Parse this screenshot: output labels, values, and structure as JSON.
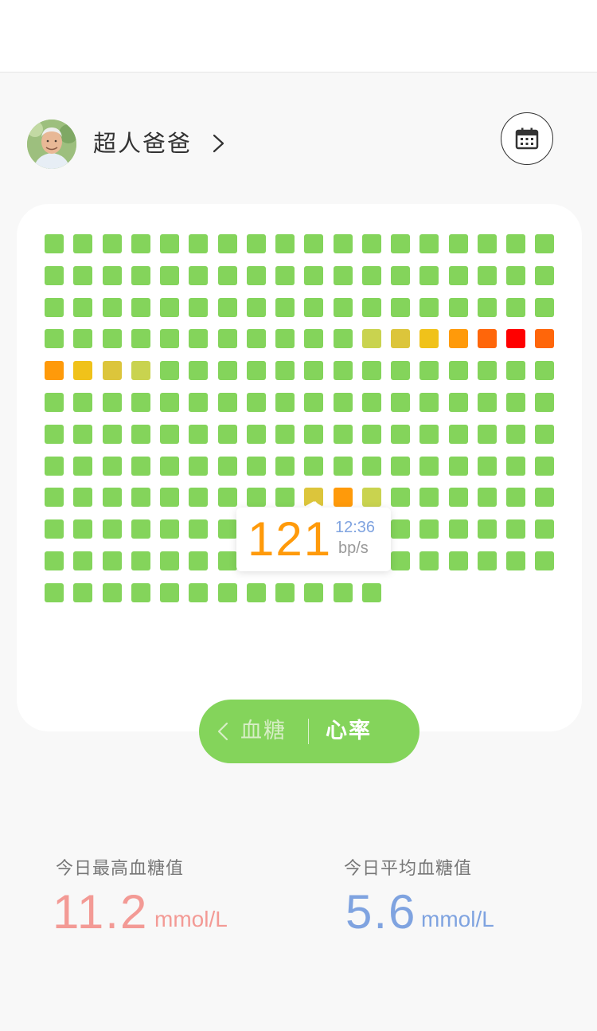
{
  "user": {
    "name": "超人爸爸"
  },
  "icons": {
    "avatar": "avatar-photo",
    "profile_chevron": "chevron-right-icon",
    "calendar": "calendar-icon",
    "back": "chevron-left-icon"
  },
  "grid": {
    "columns": 18,
    "colors": {
      "g": "#84d45b",
      "y": "#c9d34f",
      "m": "#dcc53b",
      "s": "#f0c21a",
      "o": "#ff9a0a",
      "d": "#ff660a",
      "r": "#ff0000"
    },
    "rows": [
      "gggggggggggggggggg",
      "gggggggggggggggggg",
      "gggggggggggggggggg",
      "gggggggggggymsodrd",
      "osmygggggggggggggg",
      "gggggggggggggggggg",
      "gggggggggggggggggg",
      "gggggggggggggggggg",
      "gggggggggmoygggggg",
      "gggggggggggggggggg",
      "gggggggggggggggggg",
      "gggggggggggg"
    ],
    "selected": {
      "row": 8,
      "col": 9
    }
  },
  "tooltip": {
    "value": "121",
    "time": "12:36",
    "unit": "bp/s"
  },
  "toggle": {
    "option_a": "血糖",
    "option_b": "心率",
    "active": "心率"
  },
  "stats": {
    "max": {
      "label": "今日最高血糖值",
      "value": "11.2",
      "unit": "mmol/L",
      "color": "#f39a95"
    },
    "avg": {
      "label": "今日平均血糖值",
      "value": "5.6",
      "unit": "mmol/L",
      "color": "#7fa3e0"
    }
  }
}
